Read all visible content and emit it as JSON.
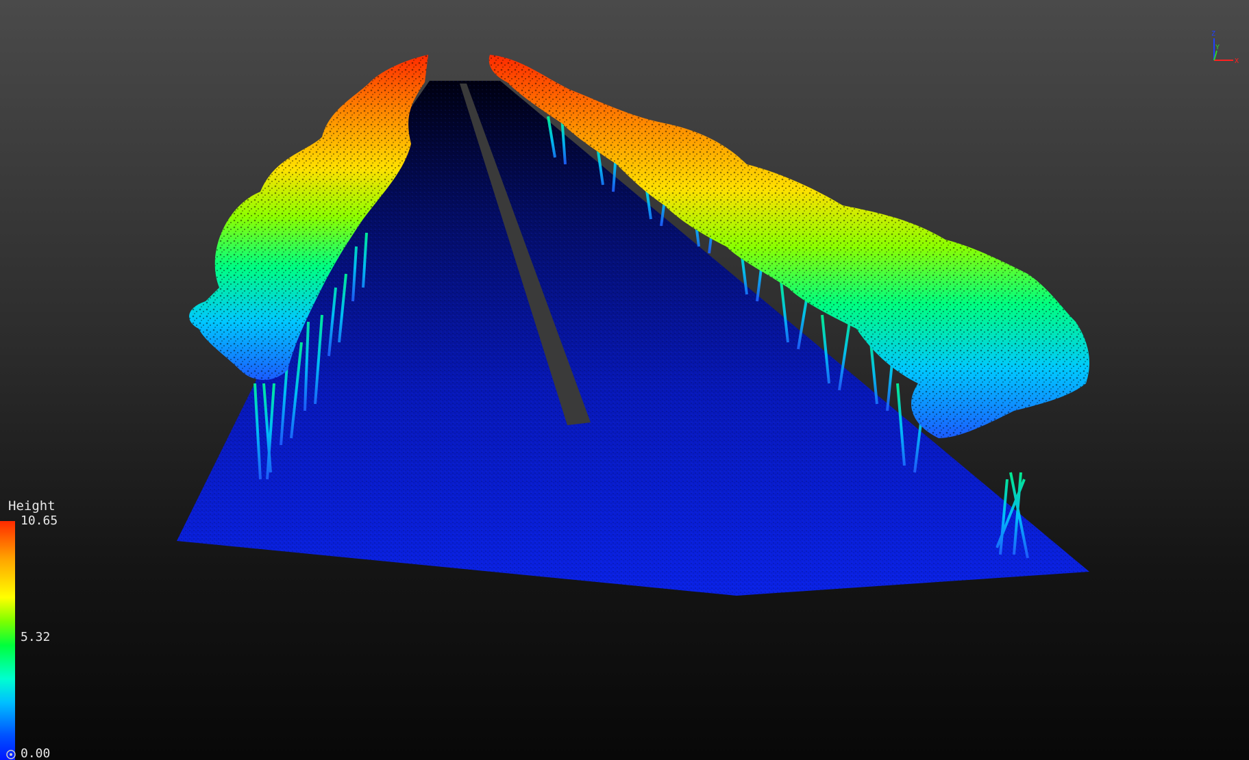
{
  "viewer": {
    "background_top": "#4a4a4a",
    "background_bottom": "#080808",
    "road_color": "#0a14c8",
    "lane_marking_color": "#3c3c3c"
  },
  "legend": {
    "title": "Height",
    "max_label": "10.65",
    "mid_label": "5.32",
    "min_label": "0.00",
    "scale_colors": [
      "#0018ff",
      "#00bfff",
      "#00ffd0",
      "#00ff3c",
      "#7dff00",
      "#ffff00",
      "#ffa500",
      "#ff2a00"
    ]
  },
  "axis_gizmo": {
    "z_label": "Z",
    "y_label": "Y",
    "x_label": "X",
    "z_color": "#2040ff",
    "y_color": "#30d030",
    "x_color": "#ff2020"
  },
  "icons": {
    "corner": "viewer-corner-icon"
  }
}
